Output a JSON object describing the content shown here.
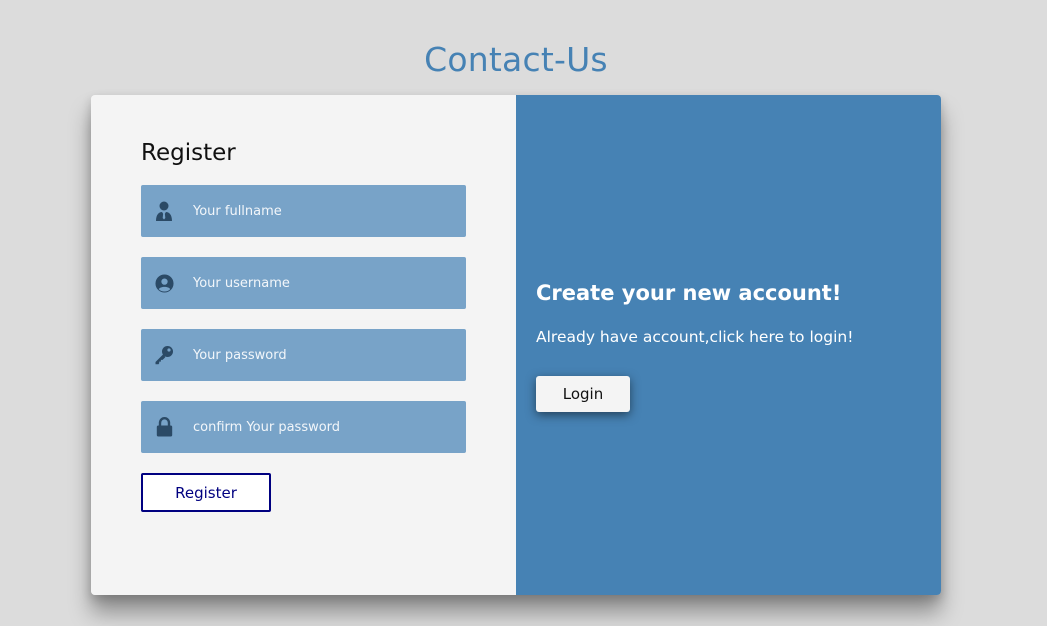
{
  "page": {
    "title": "Contact-Us"
  },
  "register_form": {
    "heading": "Register",
    "fields": [
      {
        "icon": "user-tie-icon",
        "placeholder": "Your fullname",
        "value": ""
      },
      {
        "icon": "user-circle-icon",
        "placeholder": "Your username",
        "value": ""
      },
      {
        "icon": "key-icon",
        "placeholder": "Your password",
        "value": ""
      },
      {
        "icon": "lock-icon",
        "placeholder": "confirm Your password",
        "value": ""
      }
    ],
    "submit_label": "Register"
  },
  "login_panel": {
    "heading": "Create your new account!",
    "text": "Already have account,click here to login!",
    "button_label": "Login"
  },
  "colors": {
    "accent": "#4682b4",
    "field_bg": "#78a3c8",
    "icon": "#2b4a66",
    "register_button": "#000080",
    "page_bg": "#dcdcdc",
    "form_bg": "#f4f4f4"
  }
}
